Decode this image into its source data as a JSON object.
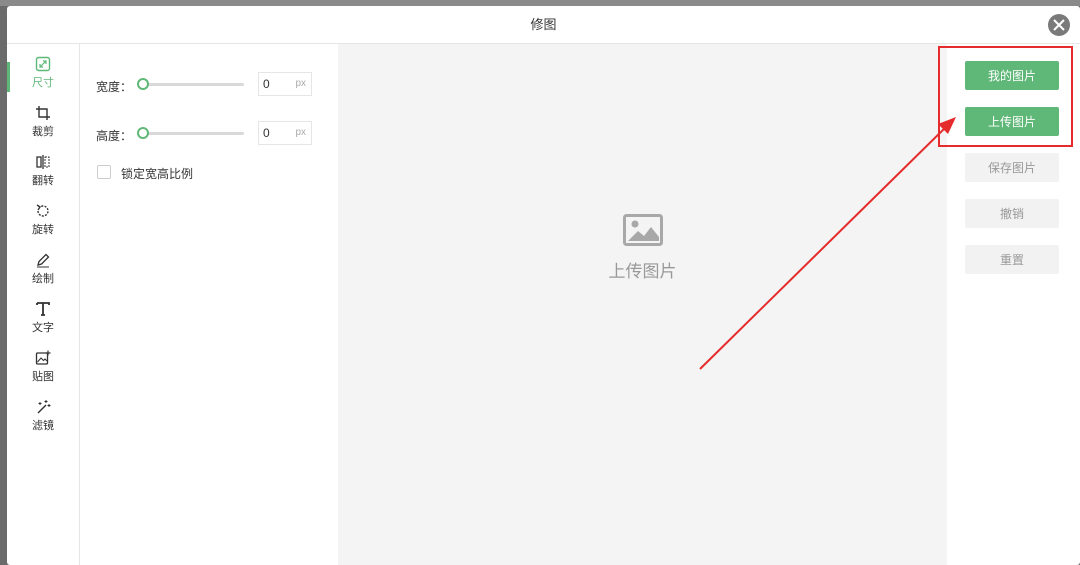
{
  "dialog": {
    "title": "修图"
  },
  "tools": [
    {
      "label": "尺寸",
      "icon": "resize-icon",
      "active": true
    },
    {
      "label": "裁剪",
      "icon": "crop-icon",
      "active": false
    },
    {
      "label": "翻转",
      "icon": "flip-icon",
      "active": false
    },
    {
      "label": "旋转",
      "icon": "rotate-icon",
      "active": false
    },
    {
      "label": "绘制",
      "icon": "pencil-icon",
      "active": false
    },
    {
      "label": "文字",
      "icon": "text-icon",
      "active": false
    },
    {
      "label": "贴图",
      "icon": "sticker-icon",
      "active": false
    },
    {
      "label": "滤镜",
      "icon": "filter-icon",
      "active": false
    }
  ],
  "panel": {
    "width": {
      "label": "宽度：",
      "value": "0",
      "unit": "px",
      "slider_fraction": 0
    },
    "height": {
      "label": "高度：",
      "value": "0",
      "unit": "px",
      "slider_fraction": 0
    },
    "lock_ratio": {
      "label": "锁定宽高比例",
      "checked": false
    }
  },
  "canvas": {
    "placeholder": "上传图片",
    "icon": "image-icon"
  },
  "actions": {
    "my_images": "我的图片",
    "upload": "上传图片",
    "save": "保存图片",
    "undo": "撤销",
    "reset": "重置"
  },
  "colors": {
    "accent": "#5fb878",
    "annotation": "#e52b2b"
  }
}
